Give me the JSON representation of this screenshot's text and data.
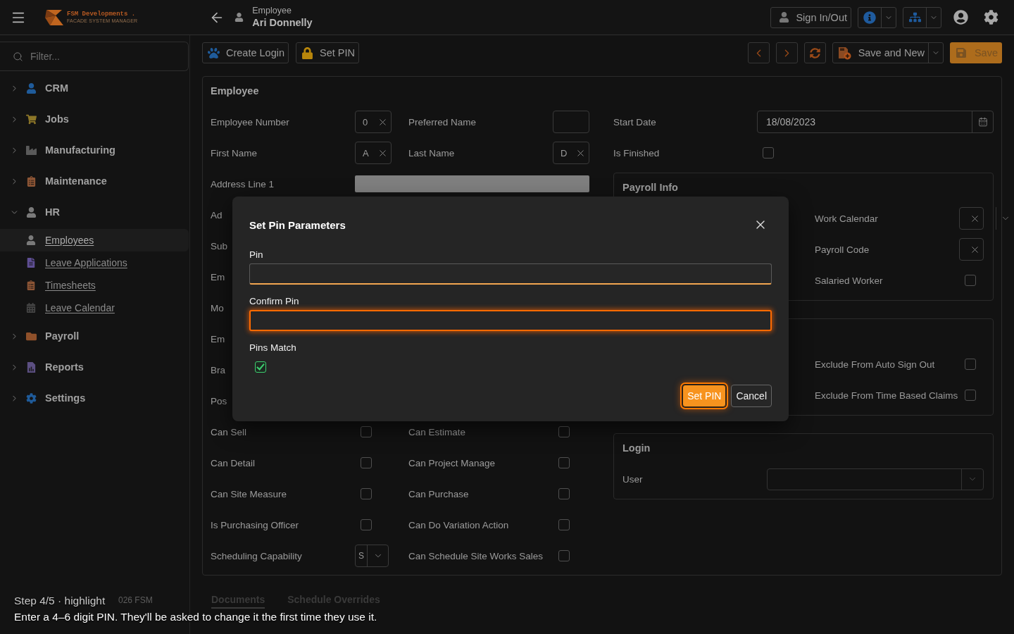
{
  "top_bar": {
    "logo": {
      "name": "FSM Developments .",
      "tagline": "FACADE SYSTEM MANAGER"
    },
    "record": {
      "type": "Employee",
      "name": "Ari Donnelly"
    },
    "sign_in_out": "Sign In/Out"
  },
  "sidebar": {
    "filter": {
      "placeholder": "Filter..."
    },
    "items": [
      {
        "label": "CRM",
        "expanded": false
      },
      {
        "label": "Jobs",
        "expanded": false
      },
      {
        "label": "Manufacturing",
        "expanded": false
      },
      {
        "label": "Maintenance",
        "expanded": false
      },
      {
        "label": "HR",
        "expanded": true,
        "children": [
          {
            "label": "Employees",
            "selected": true
          },
          {
            "label": "Leave Applications",
            "selected": false
          },
          {
            "label": "Timesheets",
            "selected": false
          },
          {
            "label": "Leave Calendar",
            "selected": false
          }
        ]
      },
      {
        "label": "Payroll",
        "expanded": false
      },
      {
        "label": "Reports",
        "expanded": false
      },
      {
        "label": "Settings",
        "expanded": false
      }
    ],
    "footer": "026 FSM"
  },
  "toolbar": {
    "left_buttons": [
      "Create Login",
      "Set PIN"
    ],
    "save_and_new": "Save and New",
    "save": "Save"
  },
  "employee": {
    "title": "Employee",
    "left_rows": [
      {
        "items": [
          {
            "label": "Employee Number",
            "kind": "clearable",
            "value": "0"
          },
          {
            "label": "Preferred Name",
            "kind": "text"
          }
        ]
      },
      {
        "items": [
          {
            "label": "First Name",
            "kind": "clearable",
            "value": "A"
          },
          {
            "label": "Last Name",
            "kind": "clearable",
            "value": "D"
          }
        ]
      },
      {
        "items": [
          {
            "label": "Address Line 1",
            "kind": "wide"
          }
        ]
      },
      {
        "items": [
          {
            "label": "Ad",
            "kind": "covered"
          }
        ]
      },
      {
        "items": [
          {
            "label": "Sub",
            "kind": "covered"
          }
        ]
      },
      {
        "items": [
          {
            "label": "Em",
            "kind": "covered"
          }
        ]
      },
      {
        "items": [
          {
            "label": "Mo",
            "kind": "covered"
          }
        ]
      },
      {
        "items": [
          {
            "label": "Em",
            "kind": "covered"
          }
        ]
      },
      {
        "items": [
          {
            "label": "Bra",
            "kind": "covered"
          }
        ]
      },
      {
        "items": [
          {
            "label": "Pos",
            "kind": "covered"
          }
        ]
      },
      {
        "items": [
          {
            "label": "Can Sell",
            "kind": "checkbox",
            "checked": false
          },
          {
            "label": "Can Estimate",
            "kind": "checkbox",
            "checked": false
          }
        ]
      },
      {
        "items": [
          {
            "label": "Can Detail",
            "kind": "checkbox",
            "checked": false
          },
          {
            "label": "Can Project Manage",
            "kind": "checkbox",
            "checked": false
          }
        ]
      },
      {
        "items": [
          {
            "label": "Can Site Measure",
            "kind": "checkbox",
            "checked": false
          },
          {
            "label": "Can Purchase",
            "kind": "checkbox",
            "checked": false
          }
        ]
      },
      {
        "items": [
          {
            "label": "Is Purchasing Officer",
            "kind": "checkbox",
            "checked": false
          },
          {
            "label": "Can Do Variation Action",
            "kind": "checkbox",
            "checked": false
          }
        ]
      },
      {
        "items": [
          {
            "label": "Scheduling Capability",
            "kind": "select",
            "value": "S"
          },
          {
            "label": "Can Schedule Site Works Sales",
            "kind": "checkbox",
            "checked": false
          }
        ]
      }
    ],
    "right_rows": [
      {
        "label": "Start Date",
        "kind": "date",
        "value": "18/08/2023"
      },
      {
        "label": "Is Finished",
        "kind": "checkbox",
        "checked": false
      }
    ],
    "groups": [
      {
        "title": "Payroll Info",
        "rows": [
          {
            "label": "Work Calendar",
            "kind": "clearable_dropdown"
          },
          {
            "label": "Payroll Code",
            "kind": "clearable"
          },
          {
            "label": "Salaried Worker",
            "kind": "checkbox",
            "checked": false
          }
        ]
      },
      {
        "rows": [
          {
            "label": "Exclude From Auto Sign Out",
            "kind": "checkbox",
            "checked": false
          },
          {
            "label": "Exclude From Time Based Claims",
            "kind": "checkbox",
            "checked": false
          }
        ]
      },
      {
        "title": "Login",
        "rows": [
          {
            "label": "User",
            "kind": "dropdown"
          }
        ]
      }
    ]
  },
  "bottom_tabs": [
    {
      "label": "Documents",
      "selected": true
    },
    {
      "label": "Schedule Overrides",
      "selected": false
    }
  ],
  "dialog": {
    "title": "Set Pin Parameters",
    "fields": [
      {
        "label": "Pin",
        "kind": "input",
        "focused": true,
        "highlighted": false
      },
      {
        "label": "Confirm Pin",
        "kind": "input",
        "focused": false,
        "highlighted": true
      },
      {
        "label": "Pins Match",
        "kind": "checkbox",
        "checked": true
      }
    ],
    "buttons": [
      {
        "label": "Set PIN",
        "primary": true,
        "highlighted": true
      },
      {
        "label": "Cancel",
        "primary": false,
        "highlighted": false
      }
    ]
  },
  "caption": {
    "step": "Step 4/5 · highlight",
    "text": "Enter a 4–6 digit PIN. They'll be asked to change it the first time they use it."
  }
}
